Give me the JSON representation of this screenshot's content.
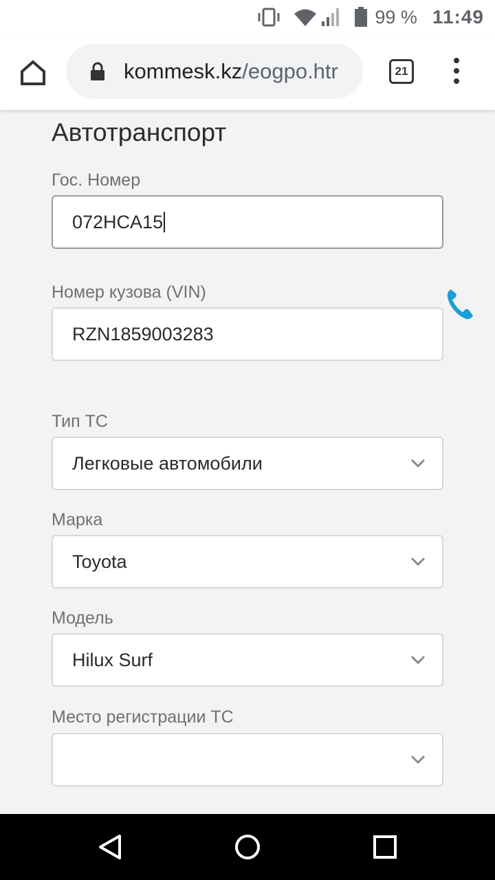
{
  "status_bar": {
    "battery_percent": "99 %",
    "time": "11:49",
    "icons": [
      "vibrate-icon",
      "wifi-icon",
      "signal-icon",
      "battery-icon"
    ]
  },
  "browser": {
    "url_domain": "kommesk.kz",
    "url_path": "/eogpo.htr",
    "tab_count": "21"
  },
  "form": {
    "section_title": "Автотранспорт",
    "fields": [
      {
        "label": "Гос. Номер",
        "value": "072HCA15",
        "type": "input"
      },
      {
        "label": "Номер кузова (VIN)",
        "value": "RZN1859003283",
        "type": "input"
      },
      {
        "label": "Тип ТС",
        "value": "Легковые автомобили",
        "type": "select"
      },
      {
        "label": "Марка",
        "value": "Toyota",
        "type": "select"
      },
      {
        "label": "Модель",
        "value": "Hilux Surf",
        "type": "select"
      },
      {
        "label": "Место регистрации ТС",
        "value": "",
        "type": "select"
      }
    ]
  },
  "colors": {
    "accent_phone": "#1a9fd6",
    "background": "#f3f3f3"
  }
}
